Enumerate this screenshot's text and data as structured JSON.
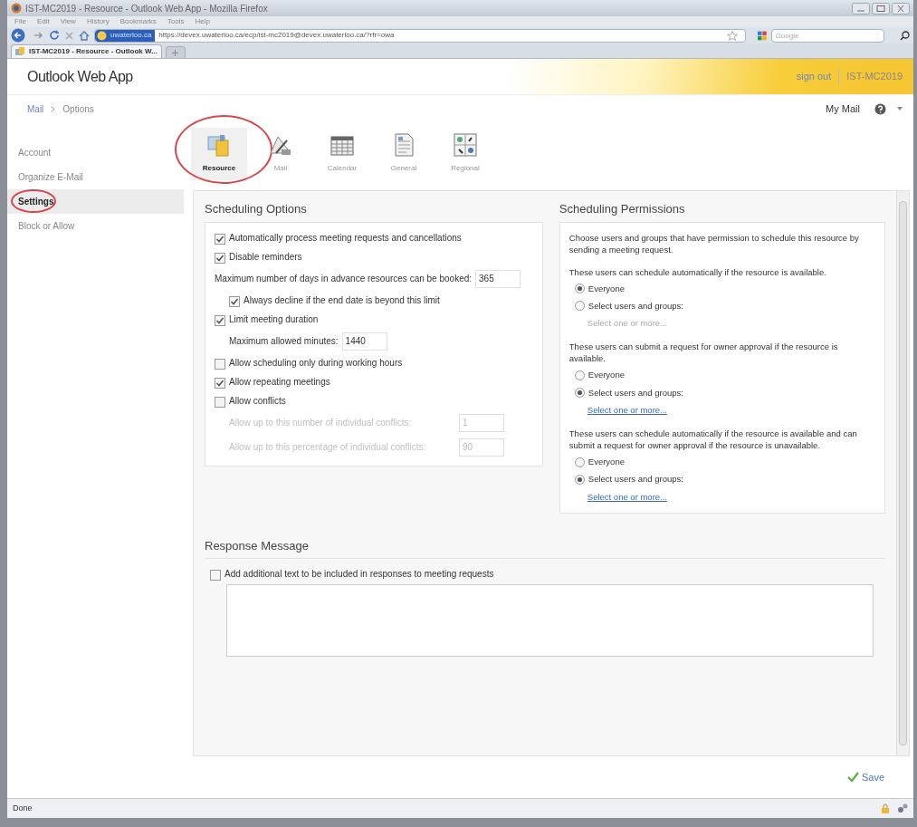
{
  "window": {
    "title": "IST-MC2019 - Resource - Outlook Web App - Mozilla Firefox"
  },
  "menu": [
    "File",
    "Edit",
    "View",
    "History",
    "Bookmarks",
    "Tools",
    "Help"
  ],
  "toolbar": {
    "identity": "uwaterloo.ca",
    "url": "https://devex.uwaterloo.ca/ecp/ist-mc2019@devex.uwaterloo.ca/?rfr=owa",
    "search_placeholder": "Google"
  },
  "tabs": [
    {
      "label": "IST-MC2019 - Resource - Outlook W...",
      "selected": true
    }
  ],
  "app": {
    "logo": "Outlook Web App",
    "sign_out": "sign out",
    "user": "IST-MC2019",
    "breadcrumb": [
      "Mail",
      "Options"
    ],
    "my_mail": "My Mail"
  },
  "sidebar": {
    "items": [
      {
        "label": "Account",
        "selected": false,
        "circled": false
      },
      {
        "label": "Organize E-Mail",
        "selected": false,
        "circled": false
      },
      {
        "label": "Settings",
        "selected": true,
        "circled": true
      },
      {
        "label": "Block or Allow",
        "selected": false,
        "circled": false
      }
    ]
  },
  "option_tabs": [
    {
      "label": "Resource",
      "selected": true,
      "circled": true
    },
    {
      "label": "Mail",
      "selected": false,
      "circled": false
    },
    {
      "label": "Calendar",
      "selected": false,
      "circled": false
    },
    {
      "label": "General",
      "selected": false,
      "circled": false
    },
    {
      "label": "Regional",
      "selected": false,
      "circled": false
    }
  ],
  "scheduling_options": {
    "title": "Scheduling Options",
    "items": [
      {
        "kind": "checkbox",
        "label": "Automatically process meeting requests and cancellations",
        "checked": true
      },
      {
        "kind": "checkbox",
        "label": "Disable reminders",
        "checked": true
      },
      {
        "kind": "number",
        "label": "Maximum number of days in advance resources can be booked:",
        "value": "365",
        "disabled": false,
        "children": [
          {
            "kind": "checkbox",
            "label": "Always decline if the end date is beyond this limit",
            "checked": true
          }
        ]
      },
      {
        "kind": "checkbox",
        "label": "Limit meeting duration",
        "checked": true,
        "children": [
          {
            "kind": "number",
            "label": "Maximum allowed minutes:",
            "value": "1440",
            "disabled": false
          }
        ]
      },
      {
        "kind": "checkbox",
        "label": "Allow scheduling only during working hours",
        "checked": false
      },
      {
        "kind": "checkbox",
        "label": "Allow repeating meetings",
        "checked": true
      },
      {
        "kind": "checkbox",
        "label": "Allow conflicts",
        "checked": false,
        "children": [
          {
            "kind": "number",
            "label": "Allow up to this number of individual conflicts:",
            "value": "1",
            "disabled": true
          },
          {
            "kind": "number",
            "label": "Allow up to this percentage of individual conflicts:",
            "value": "90",
            "disabled": true
          }
        ]
      }
    ]
  },
  "permissions": {
    "title": "Scheduling Permissions",
    "intro": "Choose users and groups that have permission to schedule this resource by sending a meeting request.",
    "groups": [
      {
        "description": "These users can schedule automatically if the resource is available.",
        "options": [
          {
            "label": "Everyone",
            "selected": true
          },
          {
            "label": "Select users and groups:",
            "selected": false
          }
        ],
        "link": {
          "label": "Select one or more...",
          "disabled": true
        }
      },
      {
        "description": "These users can submit a request for owner approval if the resource is available.",
        "options": [
          {
            "label": "Everyone",
            "selected": false
          },
          {
            "label": "Select users and groups:",
            "selected": true
          }
        ],
        "link": {
          "label": "Select one or more...",
          "disabled": false
        }
      },
      {
        "description": "These users can schedule automatically if the resource is available and can submit a request for owner approval if the resource is unavailable.",
        "options": [
          {
            "label": "Everyone",
            "selected": false
          },
          {
            "label": "Select users and groups:",
            "selected": true
          }
        ],
        "link": {
          "label": "Select one or more...",
          "disabled": false
        }
      }
    ]
  },
  "response": {
    "title": "Response Message",
    "checkbox": {
      "label": "Add additional text to be included in responses to meeting requests",
      "checked": false
    }
  },
  "save": "Save",
  "status_bar": "Done"
}
